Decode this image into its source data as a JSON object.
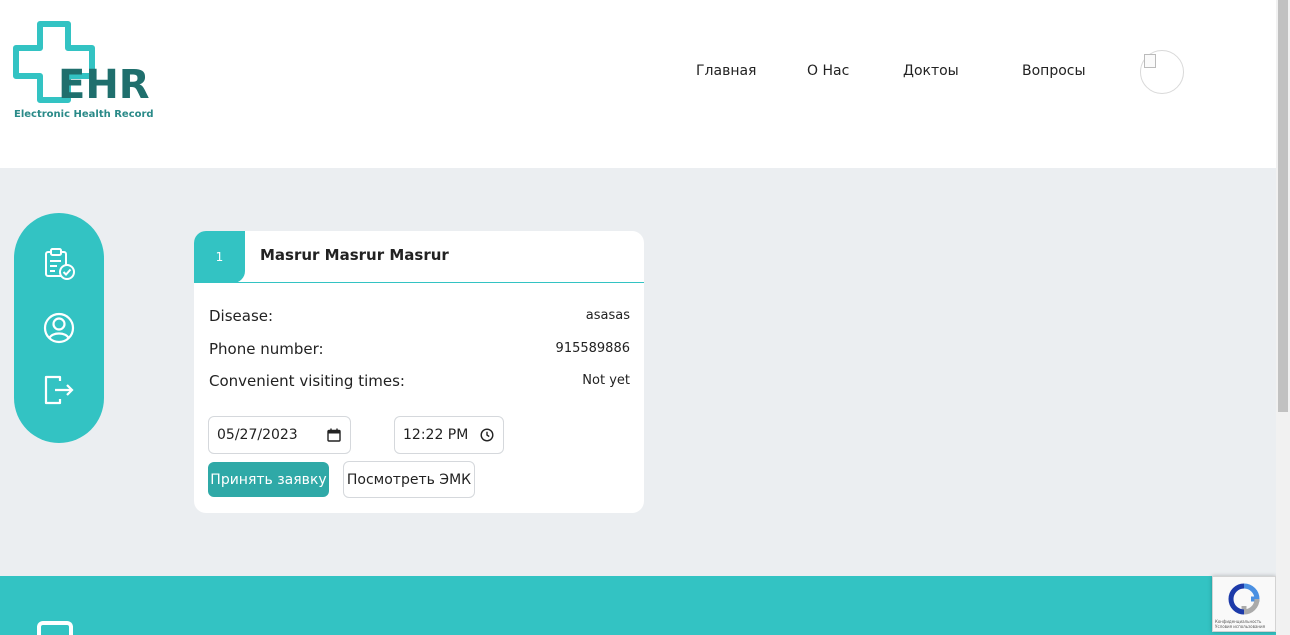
{
  "brand": {
    "logo_text": "EHR",
    "logo_subtitle": "Electronic Health Record",
    "accent_color": "#33c3c3",
    "dark_color": "#1f6f6d"
  },
  "nav": {
    "items": [
      "Главная",
      "О Нас",
      "Доктоы",
      "Вопросы"
    ]
  },
  "sidebar": {
    "icons": [
      "clipboard-check-icon",
      "user-circle-icon",
      "logout-icon"
    ]
  },
  "card": {
    "number": "1",
    "patient_name": "Masrur Masrur Masrur",
    "rows": [
      {
        "label": "Disease:",
        "value": "asasas"
      },
      {
        "label": "Phone number:",
        "value": "915589886"
      },
      {
        "label": "Convenient visiting times:",
        "value": "Not yet"
      }
    ],
    "date_value": "05/27/2023",
    "time_value": "12:22 PM",
    "accept_label": "Принять заявку",
    "view_label": "Посмотреть ЭМК"
  },
  "recaptcha": {
    "text_line1": "Конфиденциальность",
    "text_line2": "Условия использования"
  }
}
